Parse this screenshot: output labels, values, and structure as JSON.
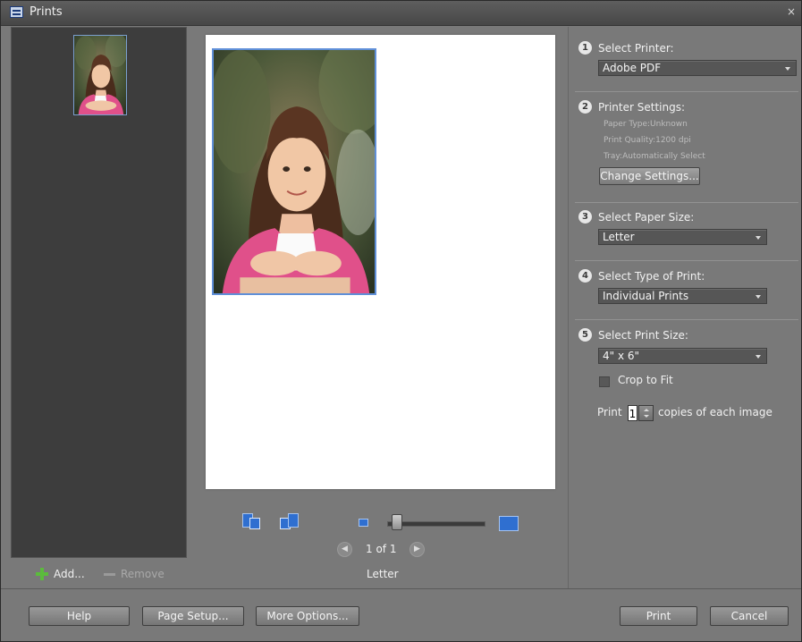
{
  "window": {
    "title": "Prints",
    "close_symbol": "×"
  },
  "left_panel": {
    "add_label": "Add...",
    "remove_label": "Remove"
  },
  "preview": {
    "page_indicator": "1 of 1",
    "paper_label": "Letter",
    "prev_symbol": "◀",
    "next_symbol": "▶",
    "zoom_level_fraction": 0.05
  },
  "settings": {
    "step1": {
      "number": "1",
      "label": "Select Printer:",
      "value": "Adobe PDF"
    },
    "step2": {
      "number": "2",
      "label": "Printer Settings:",
      "paper_type": "Paper Type:Unknown",
      "print_quality": "Print Quality:1200 dpi",
      "tray": "Tray:Automatically Select",
      "button": "Change Settings..."
    },
    "step3": {
      "number": "3",
      "label": "Select Paper Size:",
      "value": "Letter"
    },
    "step4": {
      "number": "4",
      "label": "Select Type of Print:",
      "value": "Individual Prints"
    },
    "step5": {
      "number": "5",
      "label": "Select Print Size:",
      "value": "4\" x 6\"",
      "crop_label": "Crop to Fit",
      "crop_checked": false,
      "print_prefix": "Print",
      "copies": "1",
      "copies_suffix": "copies of each image"
    }
  },
  "footer": {
    "help": "Help",
    "page_setup": "Page Setup...",
    "more_options": "More Options...",
    "print": "Print",
    "cancel": "Cancel"
  },
  "colors": {
    "accent": "#2f6fd0",
    "selection_border": "#5f8fd8",
    "panel": "#797979",
    "dark_panel": "#3d3d3d"
  }
}
